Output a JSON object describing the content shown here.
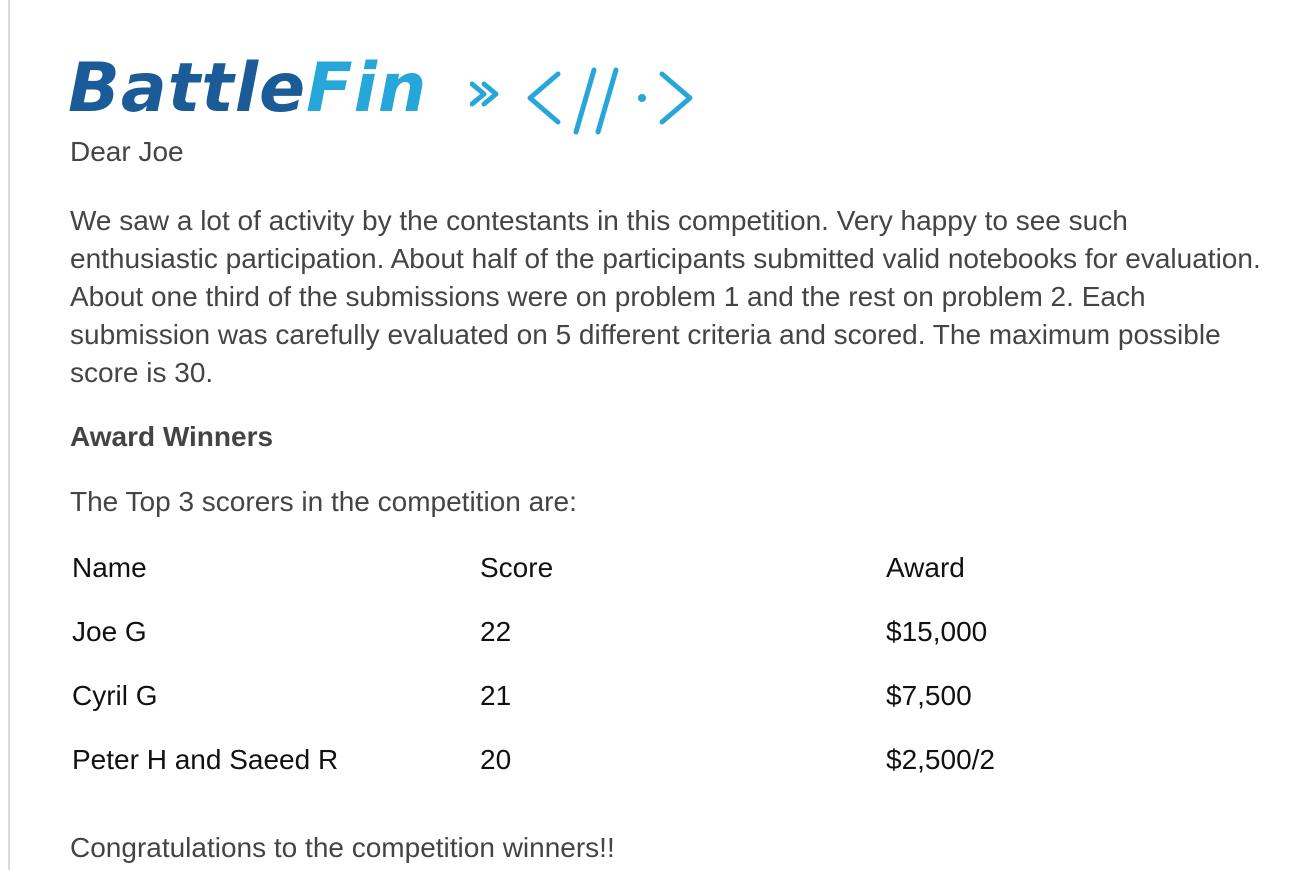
{
  "logo": {
    "brand_part1": "Battle",
    "brand_part2": "Fin",
    "mark_icon": "code-chevrons-icon",
    "colors": {
      "battle": "#1b5c98",
      "fin": "#27a7d9"
    }
  },
  "email": {
    "greeting": "Dear Joe",
    "paragraph": "We saw a lot of activity by the contestants in this competition. Very happy to see such enthusiastic participation. About half of the participants submitted valid notebooks for evaluation. About one third of the submissions were on problem 1 and the rest on problem 2. Each submission was carefully evaluated on 5 different criteria and scored. The maximum possible score is 30.",
    "heading": "Award Winners",
    "intro": "The Top 3 scorers in the competition are:",
    "table": {
      "headers": [
        "Name",
        "Score",
        "Award"
      ],
      "rows": [
        [
          "Joe G",
          "22",
          "$15,000"
        ],
        [
          "Cyril G",
          "21",
          "$7,500"
        ],
        [
          "Peter H and Saeed R",
          "20",
          "$2,500/2"
        ]
      ]
    },
    "closing": "Congratulations to the competition winners!!"
  },
  "colors": {
    "body_text": "#444444",
    "table_text": "#111111",
    "border": "#dcdcdc"
  }
}
